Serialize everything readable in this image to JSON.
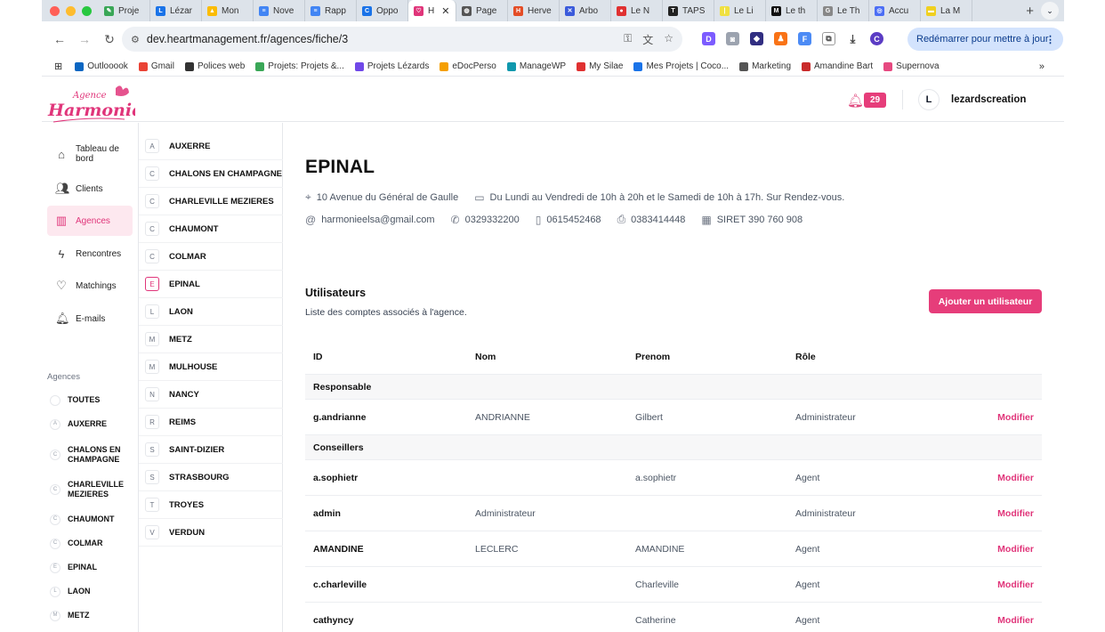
{
  "browser": {
    "tabs": [
      {
        "label": "Proje",
        "color": "#3aa757",
        "glyph": "✎"
      },
      {
        "label": "Lézar",
        "color": "#1a73e8",
        "glyph": "L"
      },
      {
        "label": "Mon",
        "color": "#fbbc04",
        "glyph": "▲"
      },
      {
        "label": "Nove",
        "color": "#4285f4",
        "glyph": "≡"
      },
      {
        "label": "Rapp",
        "color": "#4285f4",
        "glyph": "≡"
      },
      {
        "label": "Oppo",
        "color": "#1a73e8",
        "glyph": "C"
      },
      {
        "label": "H",
        "color": "#e0357a",
        "glyph": "♡",
        "active": true
      },
      {
        "label": "Page",
        "color": "#555",
        "glyph": "◍"
      },
      {
        "label": "Herve",
        "color": "#e44d26",
        "glyph": "H"
      },
      {
        "label": "Arbo",
        "color": "#3b5bdb",
        "glyph": "✕"
      },
      {
        "label": "Le N",
        "color": "#e03131",
        "glyph": "●"
      },
      {
        "label": "TAPS",
        "color": "#222",
        "glyph": "T"
      },
      {
        "label": "Le Li",
        "color": "#f0e040",
        "glyph": "|"
      },
      {
        "label": "Le th",
        "color": "#111",
        "glyph": "M"
      },
      {
        "label": "Le Th",
        "color": "#888",
        "glyph": "G"
      },
      {
        "label": "Accu",
        "color": "#4c6ef5",
        "glyph": "◎"
      },
      {
        "label": "La M",
        "color": "#f0d020",
        "glyph": "▬"
      }
    ],
    "url": "dev.heartmanagement.fr/agences/fiche/3",
    "restart_label": "Redémarrer pour mettre à jour",
    "bookmarks": [
      {
        "label": "Outlooook",
        "color": "#0a66c2"
      },
      {
        "label": "Gmail",
        "color": "#ea4335"
      },
      {
        "label": "Polices web",
        "color": "#333"
      },
      {
        "label": "Projets: Projets &...",
        "color": "#3aa757"
      },
      {
        "label": "Projets Lézards",
        "color": "#7048e8"
      },
      {
        "label": "eDocPerso",
        "color": "#f59f00"
      },
      {
        "label": "ManageWP",
        "color": "#1098ad"
      },
      {
        "label": "My Silae",
        "color": "#e03131"
      },
      {
        "label": "Mes Projets | Coco...",
        "color": "#1a73e8"
      },
      {
        "label": "Marketing",
        "color": "#555"
      },
      {
        "label": "Amandine Bart",
        "color": "#c92a2a"
      },
      {
        "label": "Supernova",
        "color": "#e64980"
      }
    ]
  },
  "header": {
    "logo_top": "Agence",
    "logo_main": "Harmonie",
    "notification_count": "29",
    "avatar_initial": "L",
    "username": "lezardscreation"
  },
  "nav": {
    "items": [
      {
        "label": "Tableau de bord",
        "icon": "home-icon"
      },
      {
        "label": "Clients",
        "icon": "users-icon"
      },
      {
        "label": "Agences",
        "icon": "building-icon"
      },
      {
        "label": "Rencontres",
        "icon": "bolt-icon"
      },
      {
        "label": "Matchings",
        "icon": "heart-icon"
      },
      {
        "label": "E-mails",
        "icon": "bell-icon"
      }
    ],
    "agences_label": "Agences",
    "agences": [
      {
        "letter": "",
        "label": "TOUTES"
      },
      {
        "letter": "A",
        "label": "AUXERRE"
      },
      {
        "letter": "C",
        "label": "CHALONS EN CHAMPAGNE"
      },
      {
        "letter": "C",
        "label": "CHARLEVILLE MEZIERES"
      },
      {
        "letter": "C",
        "label": "CHAUMONT"
      },
      {
        "letter": "C",
        "label": "COLMAR"
      },
      {
        "letter": "E",
        "label": "EPINAL"
      },
      {
        "letter": "L",
        "label": "LAON"
      },
      {
        "letter": "M",
        "label": "METZ"
      }
    ]
  },
  "cities": [
    {
      "letter": "A",
      "label": "AUXERRE"
    },
    {
      "letter": "C",
      "label": "CHALONS EN CHAMPAGNE"
    },
    {
      "letter": "C",
      "label": "CHARLEVILLE MEZIERES"
    },
    {
      "letter": "C",
      "label": "CHAUMONT"
    },
    {
      "letter": "C",
      "label": "COLMAR"
    },
    {
      "letter": "E",
      "label": "EPINAL",
      "active": true
    },
    {
      "letter": "L",
      "label": "LAON"
    },
    {
      "letter": "M",
      "label": "METZ"
    },
    {
      "letter": "M",
      "label": "MULHOUSE"
    },
    {
      "letter": "N",
      "label": "NANCY"
    },
    {
      "letter": "R",
      "label": "REIMS"
    },
    {
      "letter": "S",
      "label": "SAINT-DIZIER"
    },
    {
      "letter": "S",
      "label": "STRASBOURG"
    },
    {
      "letter": "T",
      "label": "TROYES"
    },
    {
      "letter": "V",
      "label": "VERDUN"
    }
  ],
  "agency": {
    "name": "EPINAL",
    "address": "10 Avenue du Général de Gaulle",
    "hours": "Du Lundi au Vendredi de 10h à 20h et le Samedi de 10h à 17h. Sur Rendez-vous.",
    "email": "harmonieelsa@gmail.com",
    "phone": "0329332200",
    "mobile": "0615452468",
    "fax": "0383414448",
    "siret": "SIRET 390 760 908"
  },
  "users": {
    "title": "Utilisateurs",
    "subtitle": "Liste des comptes associés à l'agence.",
    "add_button": "Ajouter un utilisateur",
    "columns": [
      "ID",
      "Nom",
      "Prenom",
      "Rôle"
    ],
    "edit_label": "Modifier",
    "rows": [
      {
        "group": "Responsable"
      },
      {
        "id": "g.andrianne",
        "nom": "ANDRIANNE",
        "prenom": "Gilbert",
        "role": "Administrateur"
      },
      {
        "group": "Conseillers"
      },
      {
        "id": "a.sophietr",
        "nom": "",
        "prenom": "a.sophietr",
        "role": "Agent"
      },
      {
        "id": "admin",
        "nom": "Administrateur",
        "prenom": "",
        "role": "Administrateur"
      },
      {
        "id": "AMANDINE",
        "nom": "LECLERC",
        "prenom": "AMANDINE",
        "role": "Agent"
      },
      {
        "id": "c.charleville",
        "nom": "",
        "prenom": "Charleville",
        "role": "Agent"
      },
      {
        "id": "cathyncy",
        "nom": "",
        "prenom": "Catherine",
        "role": "Agent"
      }
    ]
  },
  "colors": {
    "accent": "#e63d7a",
    "active_bg": "#fde8ef"
  }
}
